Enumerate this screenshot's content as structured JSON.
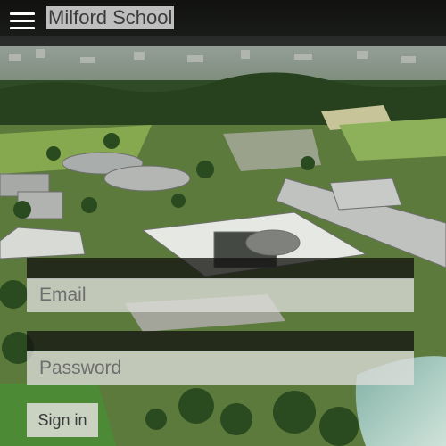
{
  "header": {
    "title": "Milford School",
    "menu_icon": "hamburger-menu-icon"
  },
  "login": {
    "email_placeholder": "Email",
    "password_placeholder": "Password",
    "signin_label": "Sign in"
  },
  "background": {
    "image": "aerial-campus-photo"
  }
}
